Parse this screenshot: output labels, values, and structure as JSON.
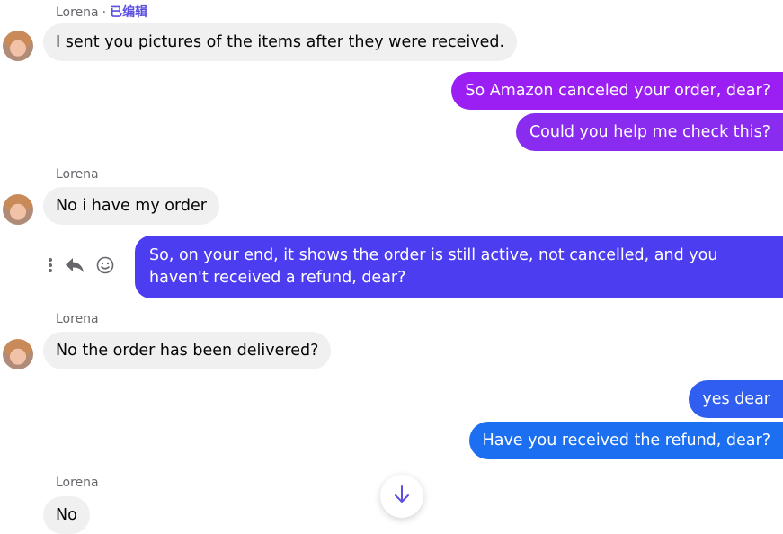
{
  "messages": {
    "sender_name": "Lorena",
    "edited_label": "已编辑",
    "m1": "I sent you pictures of the items after they were received.",
    "m2": "So Amazon canceled your order, dear?",
    "m3": "Could you help me check this?",
    "m4": "No i have my order",
    "m5": "So, on your end, it shows the order is still active, not cancelled, and you haven't received a refund, dear?",
    "m6": "No the order has been delivered?",
    "m7": "yes dear",
    "m8": "Have you received the refund, dear?",
    "m9": "No"
  },
  "icons": {
    "more": "more-vertical-icon",
    "reply": "reply-icon",
    "react": "smiley-icon",
    "scroll": "arrow-down-icon"
  },
  "colors": {
    "purple": "#9b1ef2",
    "violet": "#4c3df0",
    "blue": "#1877f2",
    "incoming": "#f0f0f0",
    "accent_text": "#5b4fe0"
  }
}
